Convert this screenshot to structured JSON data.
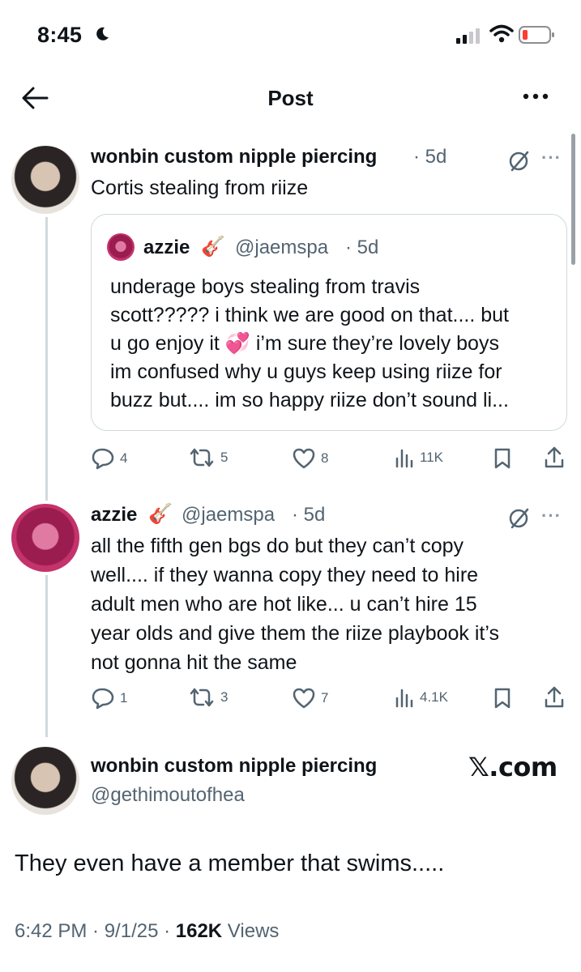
{
  "status_bar": {
    "time": "8:45"
  },
  "header": {
    "title": "Post"
  },
  "post1": {
    "author_name": "wonbin custom nipple piercing",
    "time_ago": "· 5d",
    "text": "Cortis stealing from riize",
    "quote": {
      "author_name": "azzie",
      "emoji": "🎸",
      "handle": "@jaemspa",
      "time_ago": "· 5d",
      "lines": [
        "underage boys stealing from travis",
        "scott????? i think we are good on that.... but",
        "u go enjoy it 💞  i’m sure they’re lovely boys",
        "im confused why u guys keep using riize for",
        "buzz but.... im so happy riize don’t sound li..."
      ]
    },
    "actions": {
      "replies": "4",
      "reposts": "5",
      "likes": "8",
      "views": "11K"
    }
  },
  "post2": {
    "author_name": "azzie",
    "emoji": "🎸",
    "handle": "@jaemspa",
    "time_ago": "· 5d",
    "lines": [
      "all the fifth gen bgs do but they can’t copy",
      "well.... if they wanna copy they need to hire",
      "adult men who are hot like... u can’t hire 15",
      "year olds and give them the riize playbook it’s",
      "not gonna hit the same"
    ],
    "actions": {
      "replies": "1",
      "reposts": "3",
      "likes": "7",
      "views": "4.1K"
    }
  },
  "main_post": {
    "author_name": "wonbin custom nipple piercing",
    "handle": "@gethimoutofhea",
    "watermark": "𝕏.com",
    "text": "They even have a member that swims.....",
    "timestamp": "6:42 PM · 9/1/25 · ",
    "views_count": "162K",
    "views_label": " Views"
  },
  "colors": {
    "text": "#0f1419",
    "muted": "#536471",
    "border": "#cfd9de"
  },
  "icons": [
    "moon-icon",
    "signal-icon",
    "wifi-icon",
    "battery-icon",
    "back-arrow-icon",
    "more-icon",
    "grok-icon",
    "reply-icon",
    "repost-icon",
    "like-icon",
    "views-icon",
    "bookmark-icon",
    "share-icon"
  ]
}
